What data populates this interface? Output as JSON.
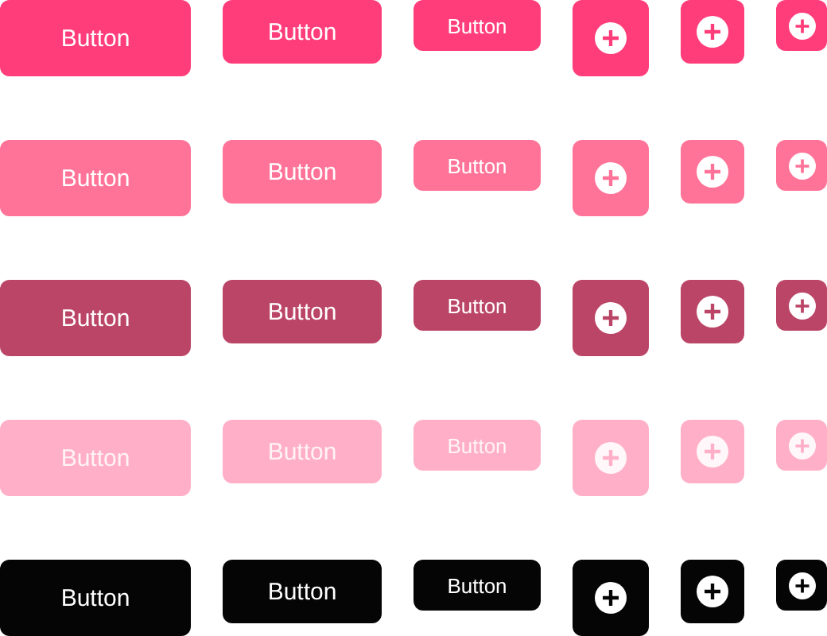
{
  "rows": [
    {
      "color": "#ff3d7a",
      "disabled": false,
      "text_buttons": [
        {
          "kind": "large",
          "label": "Button"
        },
        {
          "kind": "medium",
          "label": "Button"
        },
        {
          "kind": "small",
          "label": "Button"
        }
      ],
      "icon_buttons": [
        {
          "kind": "large"
        },
        {
          "kind": "medium"
        },
        {
          "kind": "small"
        }
      ]
    },
    {
      "color": "#ff7398",
      "disabled": false,
      "text_buttons": [
        {
          "kind": "large",
          "label": "Button"
        },
        {
          "kind": "medium",
          "label": "Button"
        },
        {
          "kind": "small",
          "label": "Button"
        }
      ],
      "icon_buttons": [
        {
          "kind": "large"
        },
        {
          "kind": "medium"
        },
        {
          "kind": "small"
        }
      ]
    },
    {
      "color": "#bb4567",
      "disabled": false,
      "text_buttons": [
        {
          "kind": "large",
          "label": "Button"
        },
        {
          "kind": "medium",
          "label": "Button"
        },
        {
          "kind": "small",
          "label": "Button"
        }
      ],
      "icon_buttons": [
        {
          "kind": "large"
        },
        {
          "kind": "medium"
        },
        {
          "kind": "small"
        }
      ]
    },
    {
      "color": "#ffb0c8",
      "disabled": true,
      "text_buttons": [
        {
          "kind": "large",
          "label": "Button"
        },
        {
          "kind": "medium",
          "label": "Button"
        },
        {
          "kind": "small",
          "label": "Button"
        }
      ],
      "icon_buttons": [
        {
          "kind": "large"
        },
        {
          "kind": "medium"
        },
        {
          "kind": "small"
        }
      ]
    },
    {
      "color": "#050505",
      "disabled": false,
      "text_buttons": [
        {
          "kind": "large",
          "label": "Button"
        },
        {
          "kind": "medium",
          "label": "Button"
        },
        {
          "kind": "small",
          "label": "Button"
        }
      ],
      "icon_buttons": [
        {
          "kind": "large"
        },
        {
          "kind": "medium"
        },
        {
          "kind": "small"
        }
      ]
    }
  ]
}
